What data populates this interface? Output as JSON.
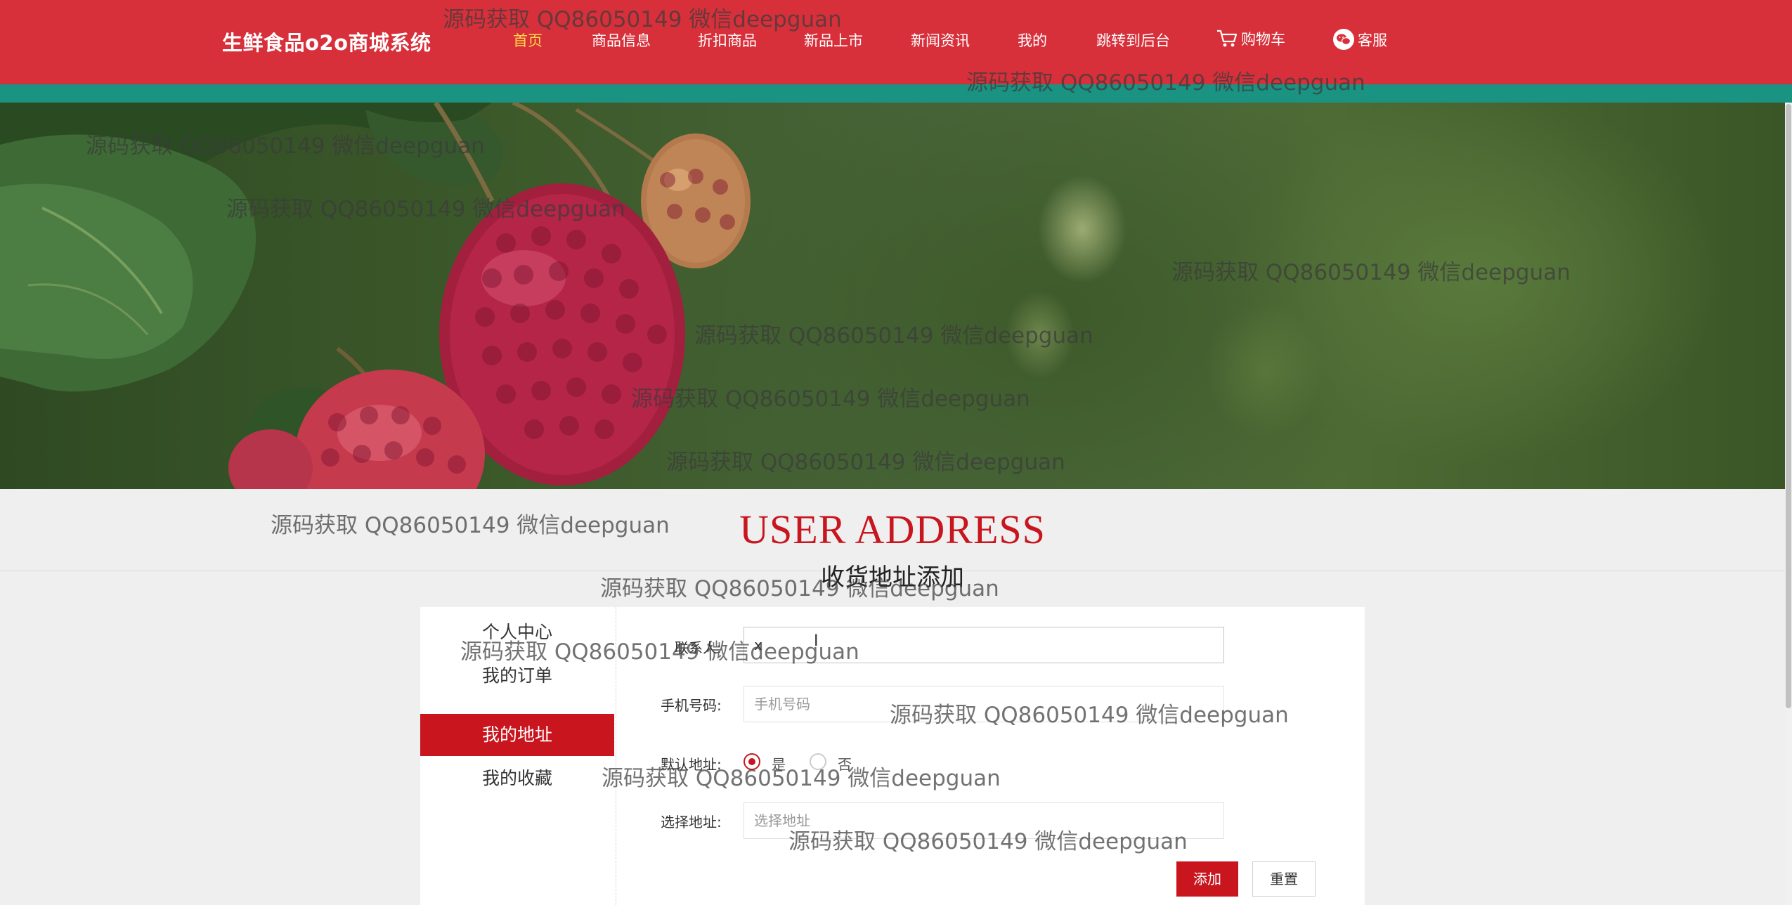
{
  "header": {
    "brand": "生鲜食品o2o商城系统",
    "nav": [
      {
        "label": "首页",
        "active": true
      },
      {
        "label": "商品信息"
      },
      {
        "label": "折扣商品"
      },
      {
        "label": "新品上市"
      },
      {
        "label": "新闻资讯"
      },
      {
        "label": "我的"
      },
      {
        "label": "跳转到后台"
      },
      {
        "label": "购物车",
        "icon": "cart-icon"
      },
      {
        "label": "客服",
        "icon": "wechat-icon"
      }
    ]
  },
  "colors": {
    "header_bg": "#d7303a",
    "strip": "#1a9383",
    "accent": "#c9151e",
    "nav_active": "#ffd94a"
  },
  "section": {
    "title": "USER ADDRESS",
    "subtitle": "收货地址添加"
  },
  "sidebar": {
    "items": [
      {
        "label": "个人中心"
      },
      {
        "label": "我的订单"
      },
      {
        "label": "我的地址",
        "active": true
      },
      {
        "label": "我的收藏"
      }
    ]
  },
  "form": {
    "contact": {
      "label": "联系人:",
      "value": "x"
    },
    "phone": {
      "label": "手机号码:",
      "placeholder": "手机号码"
    },
    "default": {
      "label": "默认地址:",
      "yes": "是",
      "no": "否",
      "selected": "是"
    },
    "address": {
      "label": "选择地址:",
      "placeholder": "选择地址"
    },
    "submit_label": "添加",
    "reset_label": "重置"
  },
  "watermark": "源码获取 QQ86050149 微信deepguan"
}
